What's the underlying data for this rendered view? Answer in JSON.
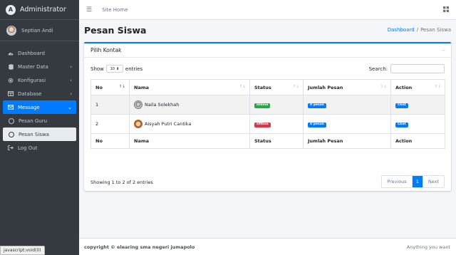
{
  "brand": {
    "title": "Administrator",
    "logo_letter": "A"
  },
  "user": {
    "name": "Septian Andi"
  },
  "nav": {
    "dashboard": "Dashboard",
    "master_data": "Master Data",
    "konfigurasi": "Konfigurasi",
    "database": "Database",
    "message": "Message",
    "pesan_guru": "Pesan Guru",
    "pesan_siswa": "Pesan Siswa",
    "logout": "Log Out"
  },
  "topbar": {
    "site_home": "Site Home"
  },
  "page": {
    "title": "Pesan Siswa"
  },
  "breadcrumb": {
    "home": "Dashboard",
    "separator": "/",
    "current": "Pesan Siswa"
  },
  "card": {
    "title": "Pilih Kontak"
  },
  "table_controls": {
    "show_label": "Show",
    "page_size": "10",
    "entries_label": "entries",
    "search_label": "Search:",
    "search_value": ""
  },
  "table": {
    "columns": [
      "No",
      "Nama",
      "Status",
      "Jumlah Pesan",
      "Action"
    ],
    "rows": [
      {
        "no": "1",
        "nama": "Naila Solekhah",
        "status": "Online",
        "jumlah": "0 pesan",
        "action": "Chat"
      },
      {
        "no": "2",
        "nama": "Aisyah Putri Cantika",
        "status": "Offline",
        "jumlah": "0 pesan",
        "action": "Chat"
      }
    ]
  },
  "info_text": "Showing 1 to 2 of 2 entries",
  "pagination": {
    "previous": "Previous",
    "current": "1",
    "next": "Next"
  },
  "footer": {
    "left": "copyright © elearing sma negeri jumapolo",
    "right": "Anything you want"
  },
  "status_bar": {
    "url": "javascript:void(0)"
  },
  "colors": {
    "accent": "#007bff",
    "sidebar": "#343a40",
    "online": "#28a745",
    "offline": "#dc3545"
  }
}
